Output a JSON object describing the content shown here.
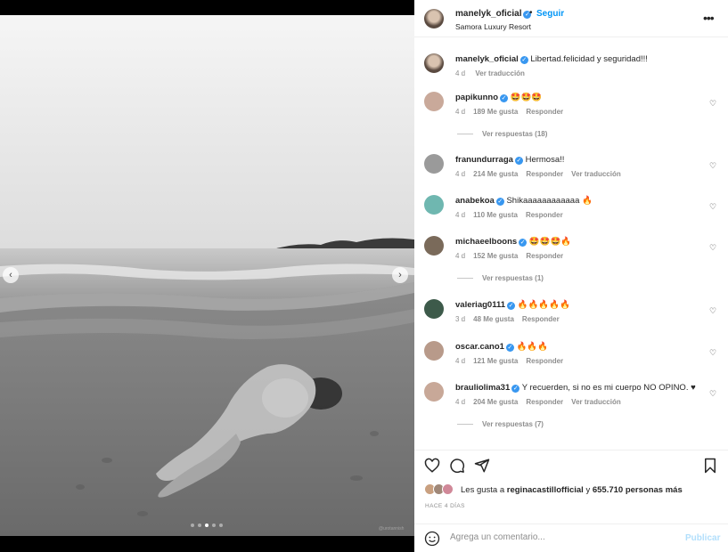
{
  "post": {
    "username": "manelyk_oficial",
    "follow_separator": "•",
    "follow_label": "Seguir",
    "location": "Samora Luxury Resort",
    "more_label": "•••",
    "watermark": "@urotannish"
  },
  "caption": {
    "username": "manelyk_oficial",
    "text": "Libertad.felicidad y seguridad!!!",
    "time": "4 d",
    "translate": "Ver traducción"
  },
  "comments": [
    {
      "username": "papikunno",
      "text": "🤩🤩🤩",
      "time": "4 d",
      "likes": "189 Me gusta",
      "reply": "Responder",
      "translate": "",
      "replies": "Ver respuestas (18)",
      "avatar_color": "#c9a99a"
    },
    {
      "username": "franundurraga",
      "text": "Hermosa!!",
      "time": "4 d",
      "likes": "214 Me gusta",
      "reply": "Responder",
      "translate": "Ver traducción",
      "replies": "",
      "avatar_color": "#9a9a9a"
    },
    {
      "username": "anabekoa",
      "text": "Shikaaaaaaaaaaaa 🔥",
      "time": "4 d",
      "likes": "110 Me gusta",
      "reply": "Responder",
      "translate": "",
      "replies": "",
      "avatar_color": "#6fb7b0"
    },
    {
      "username": "michaeelboons",
      "text": "🤩🤩🤩🔥",
      "time": "4 d",
      "likes": "152 Me gusta",
      "reply": "Responder",
      "translate": "",
      "replies": "Ver respuestas (1)",
      "avatar_color": "#7a6a5a"
    },
    {
      "username": "valeriag0111",
      "text": "🔥🔥🔥🔥🔥",
      "time": "3 d",
      "likes": "48 Me gusta",
      "reply": "Responder",
      "translate": "",
      "replies": "",
      "avatar_color": "#3d5a4a"
    },
    {
      "username": "oscar.cano1",
      "text": "🔥🔥🔥",
      "time": "4 d",
      "likes": "121 Me gusta",
      "reply": "Responder",
      "translate": "",
      "replies": "",
      "avatar_color": "#b89a8a"
    },
    {
      "username": "brauliolima31",
      "text": "Y recuerden, si no es mi cuerpo NO OPINO. ♥",
      "time": "4 d",
      "likes": "204 Me gusta",
      "reply": "Responder",
      "translate": "Ver traducción",
      "replies": "Ver respuestas (7)",
      "avatar_color": "#c8a898"
    }
  ],
  "likes": {
    "prefix": "Les gusta a",
    "user": "reginacastillofficial",
    "middle": "y",
    "count": "655.710 personas más"
  },
  "time_ago": "HACE 4 DÍAS",
  "composer": {
    "placeholder": "Agrega un comentario...",
    "post_label": "Publicar"
  },
  "carousel": {
    "total": 5,
    "active_index": 2
  },
  "icons": {
    "like": "heart-icon",
    "comment": "comment-icon",
    "share": "share-icon",
    "save": "bookmark-icon",
    "emoji": "emoji-icon",
    "prev": "chevron-left-icon",
    "next": "chevron-right-icon"
  },
  "colors": {
    "link_blue": "#0095f6",
    "verified_blue": "#3897f0",
    "muted": "#8e8e8e"
  }
}
